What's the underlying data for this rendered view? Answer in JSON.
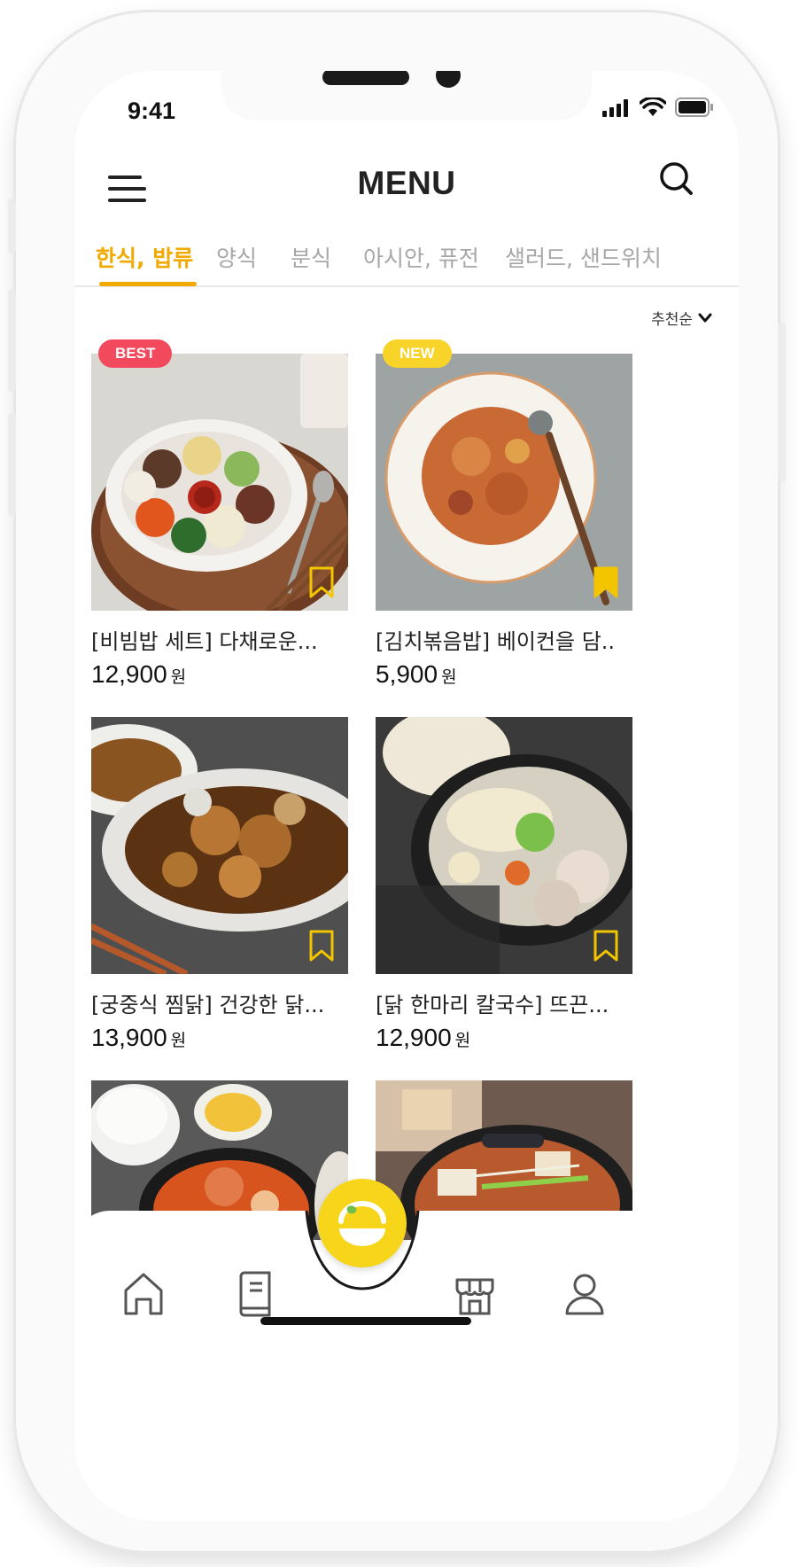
{
  "status_bar": {
    "time": "9:41"
  },
  "header": {
    "title": "MENU",
    "menu_icon": "hamburger-icon",
    "search_icon": "search-icon"
  },
  "tabs": [
    {
      "label": "한식, 밥류",
      "active": true
    },
    {
      "label": "양식",
      "active": false
    },
    {
      "label": "분식",
      "active": false
    },
    {
      "label": "아시안, 퓨전",
      "active": false
    },
    {
      "label": "샐러드, 샌드위치",
      "active": false
    }
  ],
  "sort": {
    "label": "추천순",
    "icon": "chevron-down-icon"
  },
  "products": [
    {
      "badge": "BEST",
      "name": "[비빔밥 세트] 다채로운...",
      "price": "12,900",
      "unit": "원",
      "bookmarked": false
    },
    {
      "badge": "NEW",
      "name": "[김치볶음밥] 베이컨을 담..",
      "price": "5,900",
      "unit": "원",
      "bookmarked": true
    },
    {
      "badge": "",
      "name": "[궁중식 찜닭] 건강한 닭...",
      "price": "13,900",
      "unit": "원",
      "bookmarked": false
    },
    {
      "badge": "",
      "name": "[닭 한마리 칼국수] 뜨끈...",
      "price": "12,900",
      "unit": "원",
      "bookmarked": false
    },
    {
      "badge": "",
      "name": "",
      "price": "",
      "unit": "",
      "bookmarked": false
    },
    {
      "badge": "",
      "name": "",
      "price": "",
      "unit": "",
      "bookmarked": false
    }
  ],
  "bottom_nav": {
    "items": [
      "home-icon",
      "book-icon",
      "meal-bowl-icon",
      "store-icon",
      "profile-icon"
    ]
  },
  "colors": {
    "accent": "#f2a900",
    "badge_best": "#f24a5c",
    "badge_new": "#f8d32a",
    "center_button": "#f7d51a",
    "bookmark": "#f2c500"
  }
}
